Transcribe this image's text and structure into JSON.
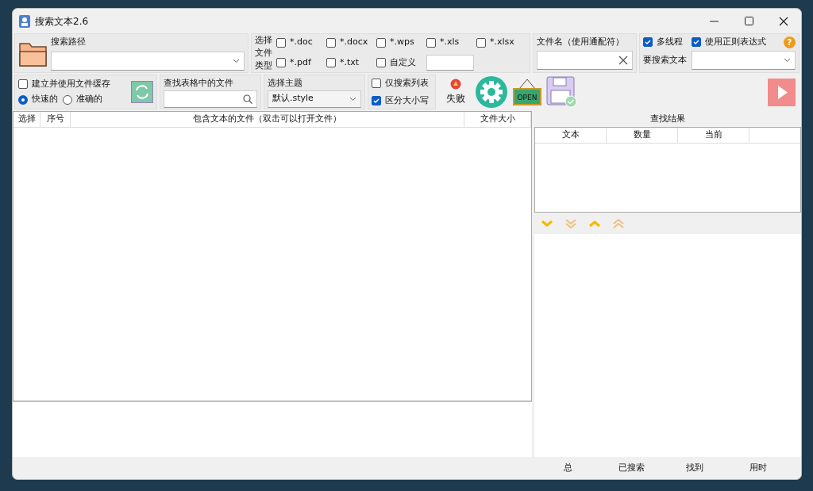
{
  "window": {
    "title": "搜索文本2.6"
  },
  "path": {
    "label": "搜索路径"
  },
  "file_types": {
    "label": "选择文件类型",
    "options": [
      {
        "kind": "checkbox",
        "label": "*.doc",
        "checked": false
      },
      {
        "kind": "checkbox",
        "label": "*.docx",
        "checked": false
      },
      {
        "kind": "checkbox",
        "label": "*.wps",
        "checked": false
      },
      {
        "kind": "checkbox",
        "label": "*.xls",
        "checked": false
      },
      {
        "kind": "checkbox",
        "label": "*.xlsx",
        "checked": false
      },
      {
        "kind": "checkbox",
        "label": "*.pdf",
        "checked": false
      },
      {
        "kind": "checkbox",
        "label": "*.txt",
        "checked": false
      },
      {
        "kind": "custom",
        "label": "自定义",
        "checked": false
      }
    ]
  },
  "filename": {
    "label": "文件名（使用通配符）"
  },
  "options": [
    {
      "label": "多线程",
      "checked": true
    },
    {
      "label": "使用正则表达式",
      "checked": true
    }
  ],
  "help": {
    "label": "?"
  },
  "search_text": {
    "label": "要搜索文本"
  },
  "cache": {
    "label": "建立并使用文件缓存",
    "checked": false,
    "modes": [
      {
        "label": "快速的",
        "selected": true
      },
      {
        "label": "准确的",
        "selected": false
      }
    ]
  },
  "table_search": {
    "label": "查找表格中的文件"
  },
  "theme": {
    "label": "选择主题",
    "value": "默认.style"
  },
  "filters": [
    {
      "label": "仅搜索列表",
      "checked": false
    },
    {
      "label": "区分大小写",
      "checked": true
    }
  ],
  "fail": {
    "label": "失败"
  },
  "open_sign": {
    "label": "OPEN"
  },
  "file_table": {
    "columns": [
      "选择",
      "序号",
      "包含文本的文件（双击可以打开文件）",
      "文件大小"
    ]
  },
  "results": {
    "title": "查找结果",
    "columns": [
      "文本",
      "数量",
      "当前"
    ]
  },
  "status_bar": [
    "总",
    "已搜索",
    "找到",
    "用时"
  ]
}
